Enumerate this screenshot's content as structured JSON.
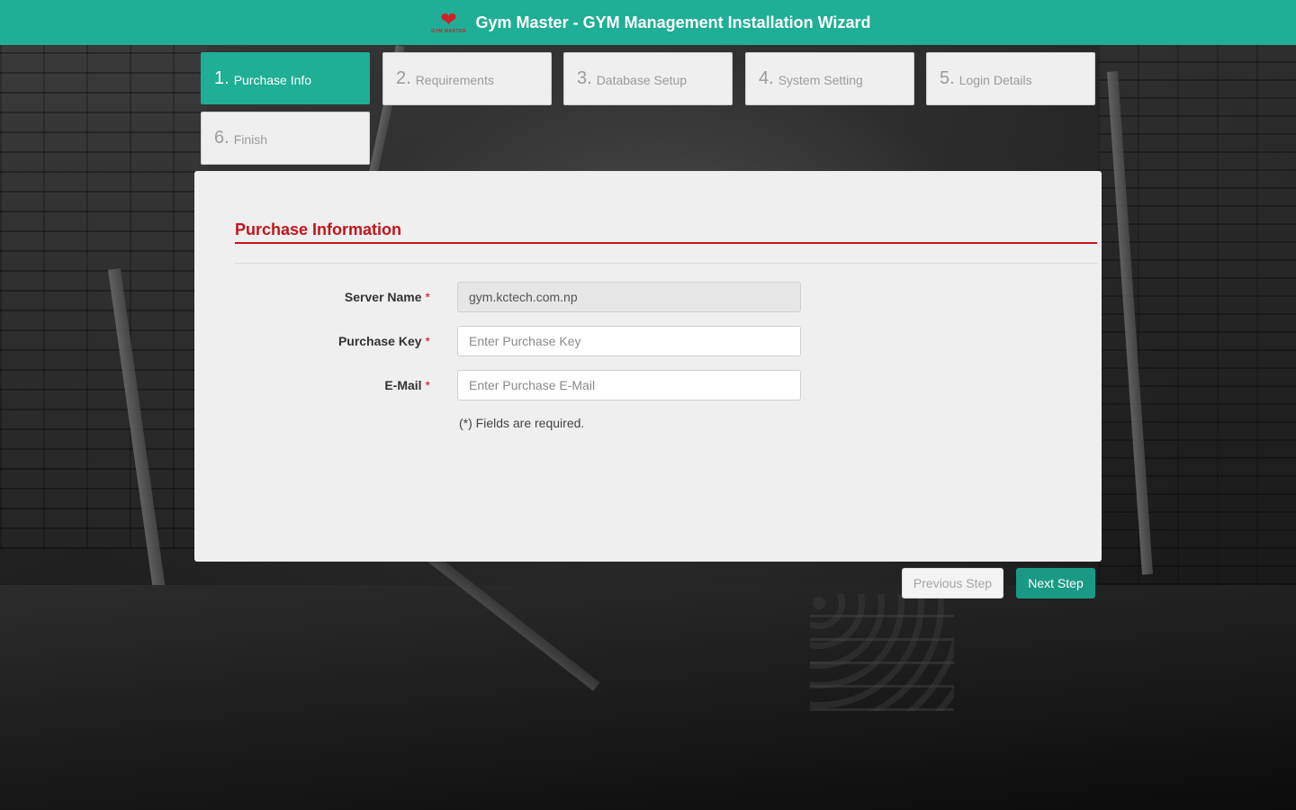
{
  "header": {
    "title": "Gym Master - GYM Management Installation Wizard",
    "logo_text": "GYM MASTER",
    "brand_color": "#1fae96",
    "logo_icon": "heart-dumbbell-icon"
  },
  "steps": [
    {
      "num": "1.",
      "label": "Purchase Info",
      "active": true
    },
    {
      "num": "2.",
      "label": "Requirements",
      "active": false
    },
    {
      "num": "3.",
      "label": "Database Setup",
      "active": false
    },
    {
      "num": "4.",
      "label": "System Setting",
      "active": false
    },
    {
      "num": "5.",
      "label": "Login Details",
      "active": false
    },
    {
      "num": "6.",
      "label": "Finish",
      "active": false
    }
  ],
  "form": {
    "section_title": "Purchase Information",
    "accent_color": "#c2141b",
    "required_mark": "*",
    "fields": [
      {
        "label": "Server Name",
        "value": "gym.kctech.com.np",
        "placeholder": "",
        "readonly": true
      },
      {
        "label": "Purchase Key",
        "value": "",
        "placeholder": "Enter Purchase Key",
        "readonly": false
      },
      {
        "label": "E-Mail",
        "value": "",
        "placeholder": "Enter Purchase E-Mail",
        "readonly": false
      }
    ],
    "note": "(*) Fields are required."
  },
  "buttons": {
    "previous": "Previous Step",
    "next": "Next Step"
  }
}
